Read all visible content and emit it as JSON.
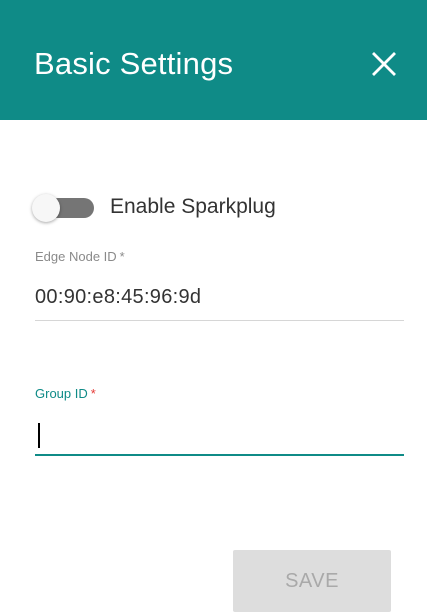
{
  "dialog": {
    "title": "Basic Settings",
    "close_icon": "close-icon",
    "header_color": "#0f8b87"
  },
  "sparkplug": {
    "label": "Enable Sparkplug",
    "enabled": false
  },
  "edge_node": {
    "label": "Edge Node ID",
    "required_mark": "*",
    "value": "00:90:e8:45:96:9d"
  },
  "group": {
    "label": "Group ID",
    "required_mark": "*",
    "value": "",
    "focused": true,
    "required_color": "#e53935"
  },
  "actions": {
    "save_label": "SAVE",
    "save_disabled": true
  }
}
